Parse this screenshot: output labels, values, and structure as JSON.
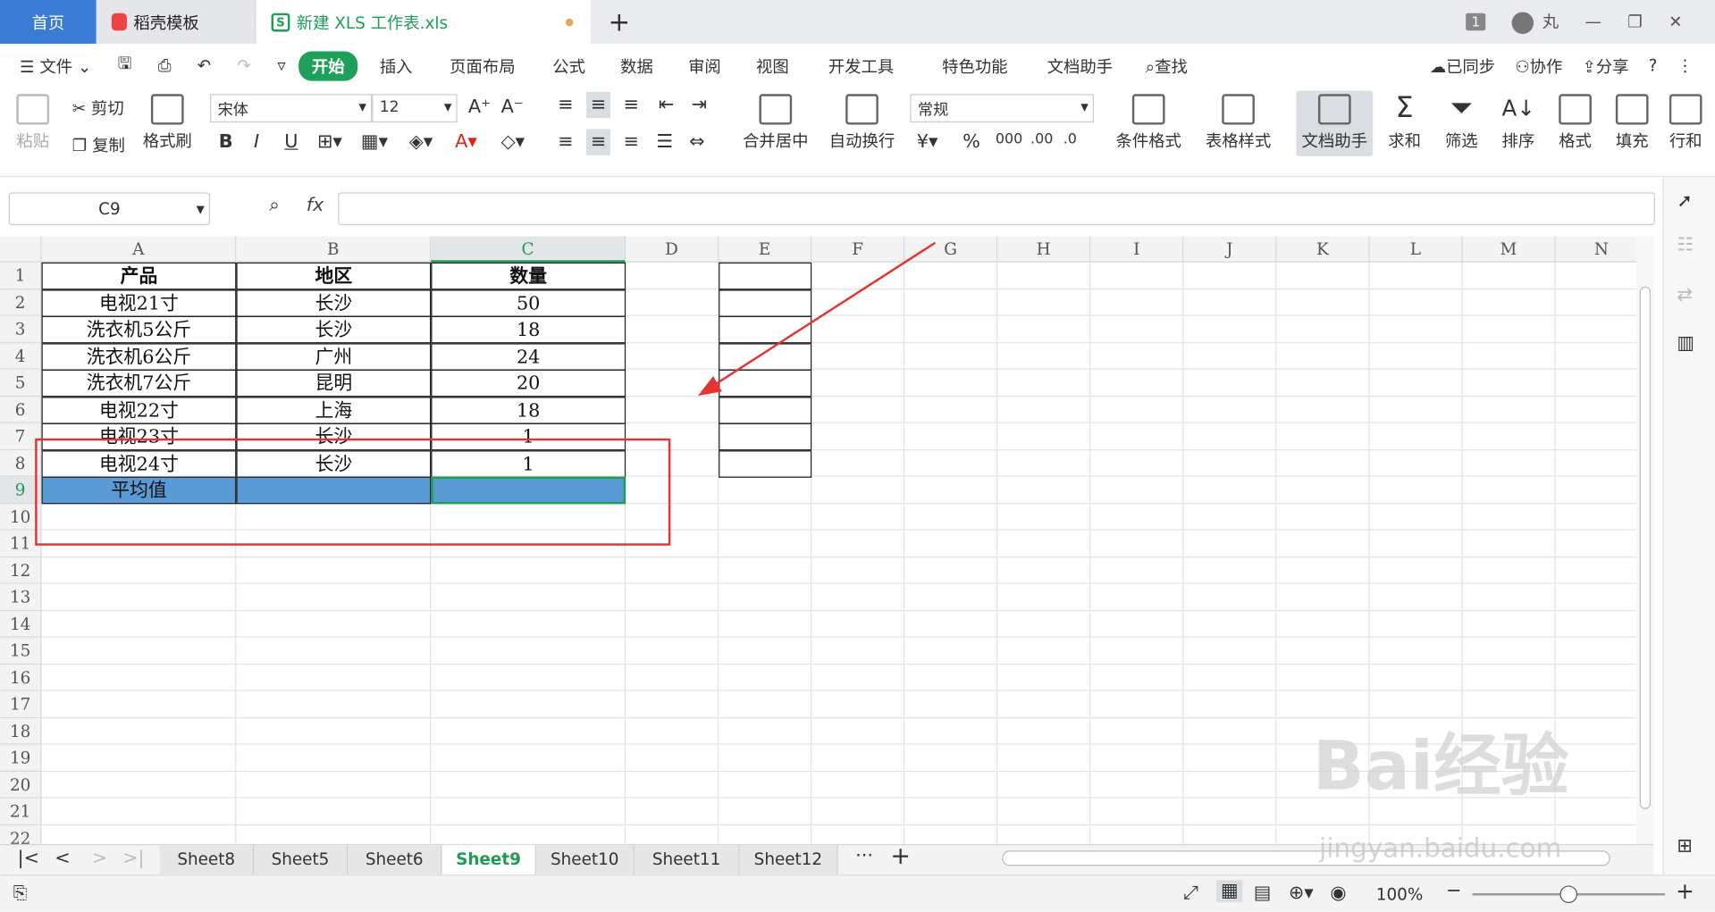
{
  "tabs": {
    "home": "首页",
    "template": "稻壳模板",
    "file": "新建 XLS 工作表.xls",
    "new_tab": "+"
  },
  "window": {
    "badge": "1",
    "user": "丸"
  },
  "menu": {
    "file": "文件",
    "items": [
      "开始",
      "插入",
      "页面布局",
      "公式",
      "数据",
      "审阅",
      "视图",
      "开发工具",
      "特色功能",
      "文档助手"
    ],
    "search": "查找",
    "sync": "已同步",
    "collab": "协作",
    "share": "分享"
  },
  "ribbon": {
    "paste": "粘贴",
    "cut": "剪切",
    "copy": "复制",
    "format_painter": "格式刷",
    "font": "宋体",
    "size": "12",
    "number_format": "常规",
    "merge": "合并居中",
    "wrap": "自动换行",
    "cond_format": "条件格式",
    "table_style": "表格样式",
    "doc_helper": "文档助手",
    "sum": "求和",
    "filter": "筛选",
    "sort": "排序",
    "format": "格式",
    "fill": "填充",
    "rowcol": "行和"
  },
  "formula_bar": {
    "cell_ref": "C9",
    "fx": "fx",
    "value": ""
  },
  "columns": [
    "A",
    "B",
    "C",
    "D",
    "E",
    "F",
    "G",
    "H",
    "I",
    "J",
    "K",
    "L",
    "M",
    "N"
  ],
  "rows": [
    "1",
    "2",
    "3",
    "4",
    "5",
    "6",
    "7",
    "8",
    "9",
    "10",
    "11",
    "12",
    "13",
    "14",
    "15",
    "16",
    "17",
    "18",
    "19",
    "20",
    "21",
    "22"
  ],
  "table": {
    "headers": [
      "产品",
      "地区",
      "数量"
    ],
    "data": [
      [
        "电视21寸",
        "长沙",
        "50"
      ],
      [
        "洗衣机5公斤",
        "长沙",
        "18"
      ],
      [
        "洗衣机6公斤",
        "广州",
        "24"
      ],
      [
        "洗衣机7公斤",
        "昆明",
        "20"
      ],
      [
        "电视22寸",
        "上海",
        "18"
      ],
      [
        "电视23寸",
        "长沙",
        "1"
      ],
      [
        "电视24寸",
        "长沙",
        "1"
      ]
    ],
    "avg_label": "平均值"
  },
  "sheets": [
    "Sheet8",
    "Sheet5",
    "Sheet6",
    "Sheet9",
    "Sheet10",
    "Sheet11",
    "Sheet12"
  ],
  "active_sheet": "Sheet9",
  "status": {
    "zoom": "100%"
  },
  "watermark": {
    "brand": "Bai经验",
    "url": "jingyan.baidu.com"
  },
  "colors": {
    "accent": "#1f9d55",
    "selection": "#5b9bd5",
    "annotation": "#e53333"
  }
}
